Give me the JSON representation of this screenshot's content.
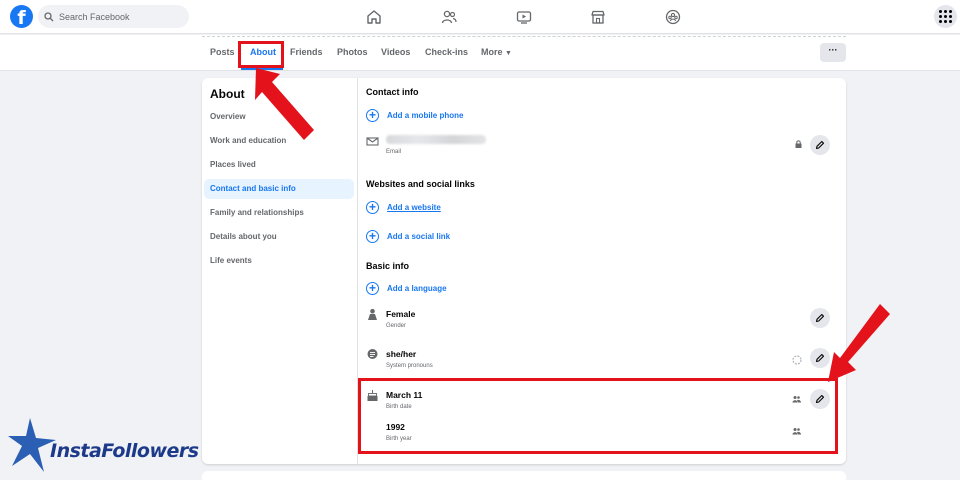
{
  "topbar": {
    "logo_letter": "f",
    "search_placeholder": "Search Facebook",
    "nav_icons": [
      "home-icon",
      "friends-icon",
      "watch-icon",
      "marketplace-icon",
      "groups-icon"
    ],
    "menu_icon": "grid-menu-icon"
  },
  "tabs": {
    "items": [
      "Posts",
      "About",
      "Friends",
      "Photos",
      "Videos",
      "Check-ins",
      "More"
    ],
    "active": "About",
    "more_caret": "▼",
    "actions_label": "···"
  },
  "sidebar": {
    "title": "About",
    "items": [
      "Overview",
      "Work and education",
      "Places lived",
      "Contact and basic info",
      "Family and relationships",
      "Details about you",
      "Life events"
    ],
    "active": "Contact and basic info"
  },
  "contact": {
    "title": "Contact info",
    "add_mobile": "Add a mobile phone",
    "email_label": "Email"
  },
  "websites": {
    "title": "Websites and social links",
    "add_website": "Add a website",
    "add_social": "Add a social link"
  },
  "basic": {
    "title": "Basic info",
    "add_language": "Add a language",
    "gender_value": "Female",
    "gender_label": "Gender",
    "pronouns_value": "she/her",
    "pronouns_label": "System pronouns",
    "birth_date_value": "March 11",
    "birth_date_label": "Birth date",
    "birth_year_value": "1992",
    "birth_year_label": "Birth year"
  },
  "watermark": {
    "text": "InstaFollowers"
  },
  "colors": {
    "accent": "#1877f2",
    "highlight": "#e3121b",
    "background": "#f0f2f5"
  }
}
